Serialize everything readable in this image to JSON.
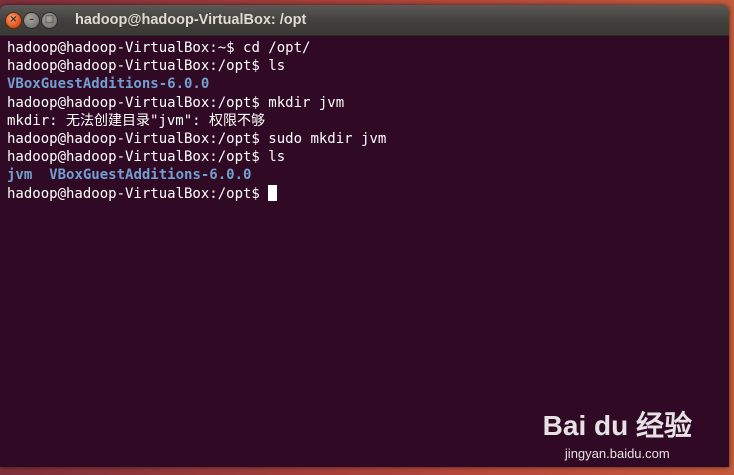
{
  "window": {
    "title": "hadoop@hadoop-VirtualBox: /opt",
    "controls": {
      "close": "×",
      "minimize": "–",
      "maximize": "□"
    }
  },
  "terminal": {
    "lines": [
      {
        "prompt": "hadoop@hadoop-VirtualBox:~$ ",
        "command": "cd /opt/"
      },
      {
        "prompt": "hadoop@hadoop-VirtualBox:/opt$ ",
        "command": "ls"
      },
      {
        "dir_entries": [
          "VBoxGuestAdditions-6.0.0"
        ]
      },
      {
        "prompt": "hadoop@hadoop-VirtualBox:/opt$ ",
        "command": "mkdir jvm"
      },
      {
        "output": "mkdir: 无法创建目录\"jvm\": 权限不够"
      },
      {
        "prompt": "hadoop@hadoop-VirtualBox:/opt$ ",
        "command": "sudo mkdir jvm"
      },
      {
        "prompt": "hadoop@hadoop-VirtualBox:/opt$ ",
        "command": "ls"
      },
      {
        "dir_entries": [
          "jvm",
          "VBoxGuestAdditions-6.0.0"
        ]
      },
      {
        "prompt": "hadoop@hadoop-VirtualBox:/opt$ ",
        "command": "",
        "cursor": true
      }
    ]
  },
  "watermark": {
    "logo": "Bai du 经验",
    "url": "jingyan.baidu.com"
  },
  "colors": {
    "terminal_bg": "#300a24",
    "directory": "#729fcf",
    "text": "#ffffff"
  }
}
